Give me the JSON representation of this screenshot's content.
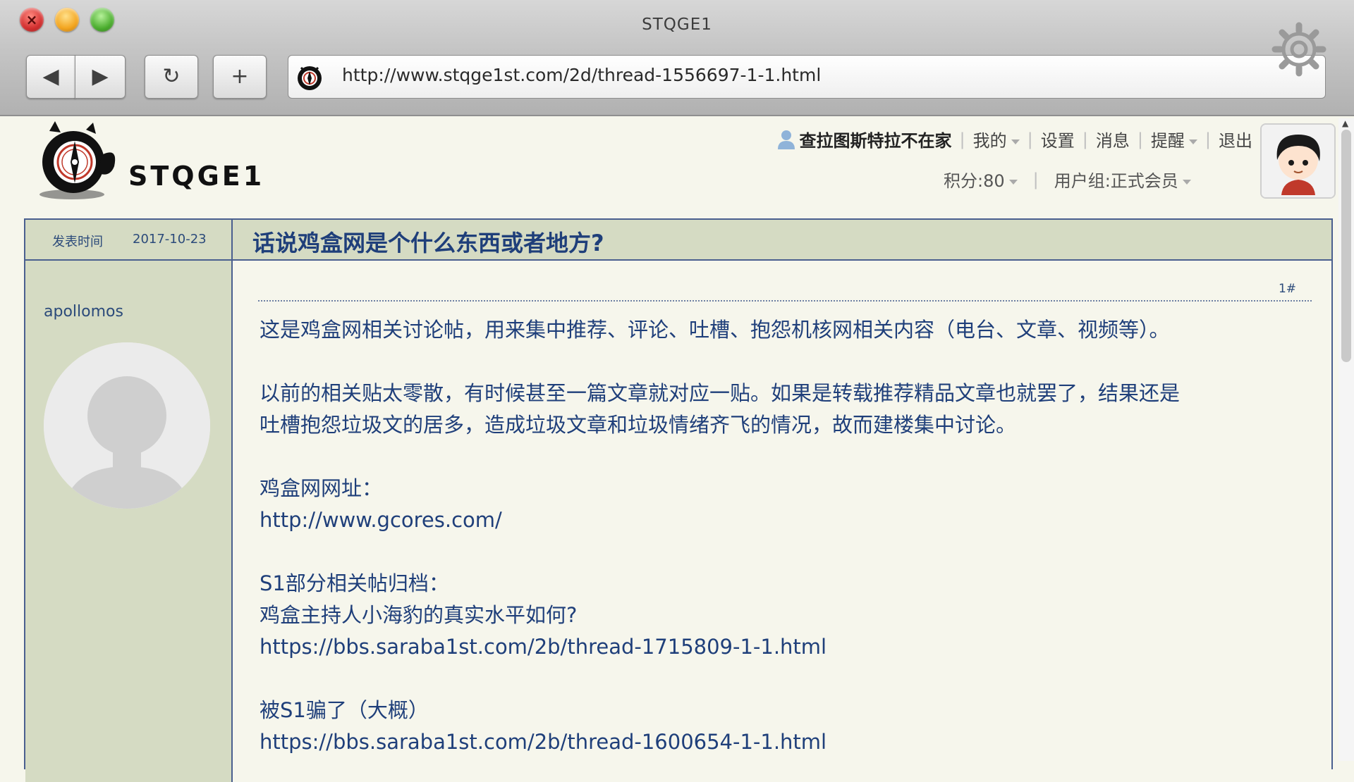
{
  "window": {
    "title": "STQGE1"
  },
  "toolbar": {
    "back_glyph": "◀",
    "forward_glyph": "▶",
    "reload_glyph": "↻",
    "new_tab_glyph": "+",
    "url": "http://www.stqge1st.com/2d/thread-1556697-1-1.html"
  },
  "site": {
    "name": "STQGE1"
  },
  "user_nav": {
    "username": "查拉图斯特拉不在家",
    "my": "我的",
    "settings": "设置",
    "messages": "消息",
    "reminders": "提醒",
    "logout": "退出",
    "points": "积分:80",
    "group": "用户组:正式会员"
  },
  "thread": {
    "posted_label": "发表时间",
    "posted_date": "2017-10-23",
    "title": "话说鸡盒网是个什么东西或者地方?",
    "author": "apollomos",
    "floor": "1#",
    "body": {
      "line1": "这是鸡盒网相关讨论帖，用来集中推荐、评论、吐槽、抱怨机核网相关内容（电台、文章、视频等）。",
      "line2": "以前的相关贴太零散，有时候甚至一篇文章就对应一贴。如果是转载推荐精品文章也就罢了，结果还是",
      "line3": "吐槽抱怨垃圾文的居多，造成垃圾文章和垃圾情绪齐飞的情况，故而建楼集中讨论。",
      "line4": "鸡盒网网址：",
      "line5": "http://www.gcores.com/",
      "line6": "S1部分相关帖归档：",
      "line7": "鸡盒主持人小海豹的真实水平如何?",
      "line8": "https://bbs.saraba1st.com/2b/thread-1715809-1-1.html",
      "line9": "被S1骗了（大概）",
      "line10": "https://bbs.saraba1st.com/2b/thread-1600654-1-1.html"
    }
  },
  "colors": {
    "accent": "#1f3f7a",
    "panel": "#d5dbc3",
    "border": "#4a5f8f",
    "page_bg": "#f6f6ec"
  }
}
